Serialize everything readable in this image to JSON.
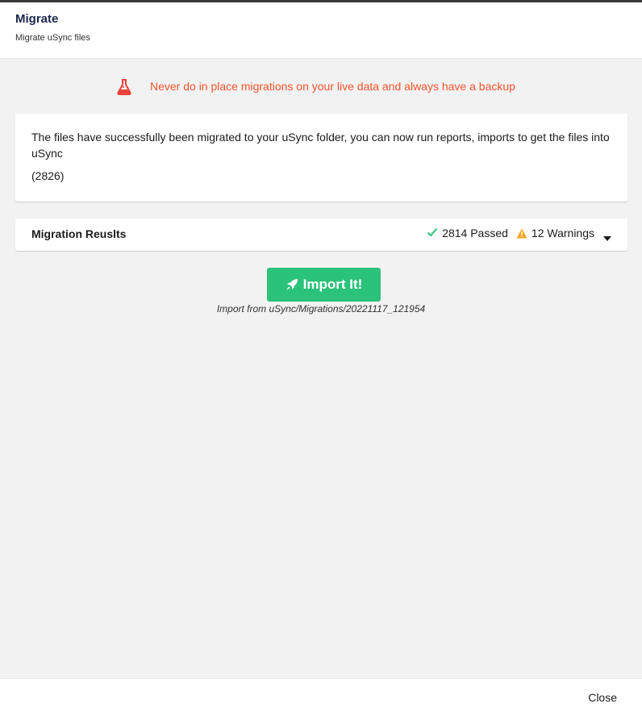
{
  "dialog": {
    "title": "Migrate",
    "subtitle": "Migrate uSync files"
  },
  "warning": {
    "icon": "flask-icon",
    "text": "Never do in place migrations on your live data and always have a backup",
    "color": "#f2542d"
  },
  "message": {
    "text": "The files have successfully been migrated to your uSync folder, you can now run reports, imports to get the files into uSync",
    "count": "(2826)"
  },
  "results": {
    "label": "Migration Reuslts",
    "passed": "2814 Passed",
    "warnings": "12 Warnings",
    "passed_icon": "check-icon",
    "warning_icon": "warning-icon",
    "toggle_icon": "caret-down-icon"
  },
  "import": {
    "button_label": "Import It!",
    "icon": "rocket-icon",
    "path_text": "Import from uSync/Migrations/20221117_121954",
    "color": "#2bc37c"
  },
  "footer": {
    "close_label": "Close"
  }
}
